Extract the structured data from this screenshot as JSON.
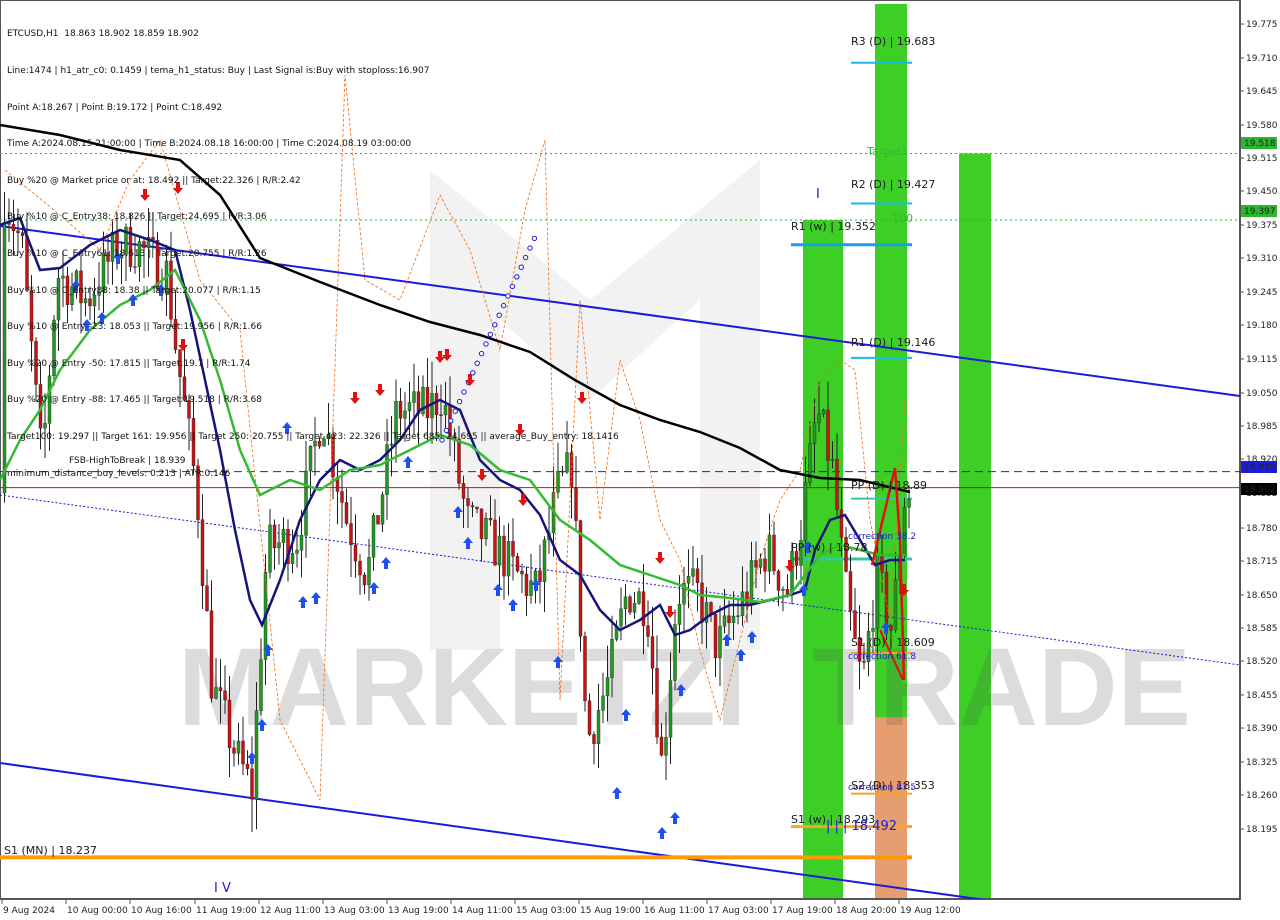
{
  "info_lines": [
    "ETCUSD,H1  18.863 18.902 18.859 18.902",
    "Line:1474 | h1_atr_c0: 0.1459 | tema_h1_status: Buy | Last Signal is:Buy with stoploss:16.907",
    "Point A:18.267 | Point B:19.172 | Point C:18.492",
    "Time A:2024.08.15 21:00:00 | Time B:2024.08.18 16:00:00 | Time C:2024.08.19 03:00:00",
    "Buy %20 @ Market price or at: 18.492 || Target:22.326 | R/R:2.42",
    "Buy %10 @ C_Entry38: 18.826 || Target:24.695 | R/R:3.06",
    "Buy %10 @ C_Entry61: 18.613 || Target:20.755 | R/R:1.26",
    "Buy %10 @ C_Entry88: 18.38 || Target:20.077 | R/R:1.15",
    "Buy %10 @ Entry -23: 18.053 || Target:19.956 | R/R:1.66",
    "Buy %20 @ Entry -50: 17.815 || Target:19.7 | R/R:1.74",
    "Buy %20 @ Entry -88: 17.465 || Target:19.518 | R/R:3.68",
    "Target100: 19.297 || Target 161: 19.956 || Target 250: 20.755 || Target 423: 22.326 || Target 685: 24.695 || average_Buy_entry: 18.1416",
    "minimum_distance_buy_levels: 0.213 | ATR:0.146"
  ],
  "chart_data": {
    "type": "candlestick",
    "symbol": "ETCUSD",
    "timeframe": "H1",
    "ohlc_header": {
      "open": 18.863,
      "high": 18.902,
      "low": 18.859,
      "close": 18.902
    },
    "ylim": [
      18.165,
      19.79
    ],
    "price_ticks": [
      "19.775",
      "19.710",
      "19.645",
      "19.580",
      "19.515",
      "19.450",
      "19.375",
      "19.310",
      "19.245",
      "19.180",
      "19.115",
      "19.050",
      "18.985",
      "18.920",
      "18.855",
      "18.780",
      "18.715",
      "18.650",
      "18.585",
      "18.520",
      "18.455",
      "18.390",
      "18.325",
      "18.260",
      "18.195"
    ],
    "time_labels": [
      "9 Aug 2024",
      "10 Aug 00:00",
      "10 Aug 16:00",
      "11 Aug 19:00",
      "12 Aug 11:00",
      "13 Aug 03:00",
      "13 Aug 19:00",
      "14 Aug 11:00",
      "15 Aug 03:00",
      "15 Aug 19:00",
      "16 Aug 11:00",
      "17 Aug 03:00",
      "17 Aug 19:00",
      "18 Aug 20:00",
      "19 Aug 12:00"
    ],
    "price_badges": [
      {
        "text": "19.518",
        "price": 19.518,
        "bg": "#2db52d"
      },
      {
        "text": "19.397",
        "price": 19.397,
        "bg": "#2db52d"
      },
      {
        "text": "18.939",
        "price": 18.939,
        "bg": "#1e1ed2"
      },
      {
        "text": "18.902",
        "price": 18.902,
        "bg": "#000000"
      }
    ],
    "levels": [
      {
        "label": "R3 (D) | 19.683",
        "price": 19.683,
        "color": "#18b8e8"
      },
      {
        "label": "R2 (D) | 19.427",
        "price": 19.427,
        "color": "#18b8e8"
      },
      {
        "label": "R1 (w) | 19.352",
        "price": 19.352,
        "color": "#1a9fe8"
      },
      {
        "label": "R1 (D) | 19.146",
        "price": 19.146,
        "color": "#18b8e8"
      },
      {
        "label": "PP (D) | 18.89",
        "price": 18.89,
        "color": "#2ec8a8"
      },
      {
        "label": "PP (w) | 18.78",
        "price": 18.78,
        "color": "#2ec8a8"
      },
      {
        "label": "S1 (D) | 18.609",
        "price": 18.609,
        "color": "#f5a623"
      },
      {
        "label": "S2 (D) | 18.353",
        "price": 18.353,
        "color": "#f5a623"
      },
      {
        "label": "S1 (w) | 18.293",
        "price": 18.293,
        "color": "#f5a623"
      },
      {
        "label": "S1 (MN) | 18.237",
        "price": 18.237,
        "color": "#ff9900"
      }
    ],
    "text_annotations": {
      "fsb": "FSB-HighToBreak | 18.939",
      "target1": "Target1",
      "t100": "100",
      "corr382": "correction 38.2",
      "corr618": "correction 61.8",
      "corr875": "correction 87.5",
      "point_c": "| | | 18.492",
      "wave_iv": "I V",
      "wave_i": "I"
    },
    "legend": "none",
    "grid": false
  },
  "colors": {
    "bull": "#1f9c1f",
    "bear": "#cc1111",
    "sma_black": "#000000",
    "ema_navy": "#14147a",
    "ema_green": "#33bb33",
    "channel": "#1a1ad9",
    "band_green": "#33cc1a",
    "band_salmon": "#ef9a73",
    "buy_arrow": "#1e4ff0",
    "sell_arrow": "#e01010"
  },
  "watermark": {
    "left": "MARKETZI",
    "right": "TRADE"
  }
}
